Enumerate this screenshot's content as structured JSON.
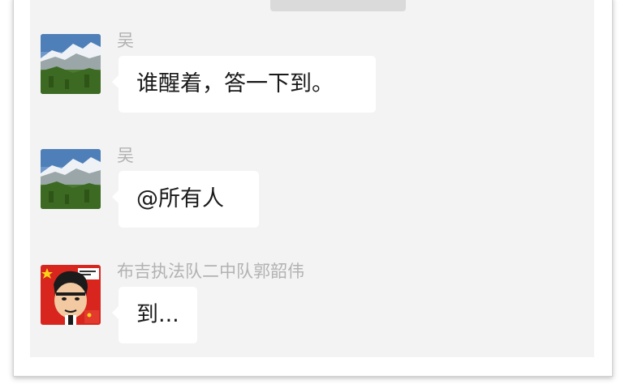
{
  "chat": {
    "timestamp": "",
    "messages": [
      {
        "sender": "吴",
        "text": "谁醒着，答一下到。",
        "avatar": "mountain-landscape-avatar"
      },
      {
        "sender": "吴",
        "text": "@所有人",
        "avatar": "mountain-landscape-avatar"
      },
      {
        "sender": "布吉执法队二中队郭韶伟",
        "text": "到...",
        "avatar": "cartoon-man-flag-avatar"
      }
    ]
  },
  "colors": {
    "chat_background": "#f3f3f3",
    "bubble": "#ffffff",
    "sender_name": "#b2b2b2",
    "timestamp_pill": "#dadada"
  }
}
